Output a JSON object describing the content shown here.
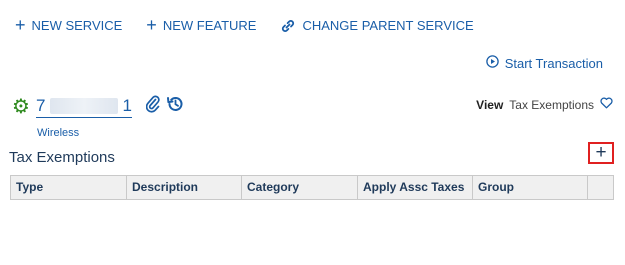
{
  "toolbar": {
    "new_service": "NEW SERVICE",
    "new_feature": "NEW FEATURE",
    "change_parent": "CHANGE PARENT SERVICE"
  },
  "start_transaction": "Start Transaction",
  "account": {
    "number_start": "7",
    "number_end": "1",
    "type": "Wireless"
  },
  "view": {
    "label": "View",
    "value": "Tax Exemptions"
  },
  "section": {
    "title": "Tax Exemptions",
    "add_label": "+"
  },
  "table": {
    "columns": [
      "Type",
      "Description",
      "Category",
      "Apply Assc Taxes",
      "Group",
      ""
    ]
  },
  "colors": {
    "accent": "#1a5ea8",
    "gear": "#2f8a1f",
    "highlight": "#e02020"
  }
}
